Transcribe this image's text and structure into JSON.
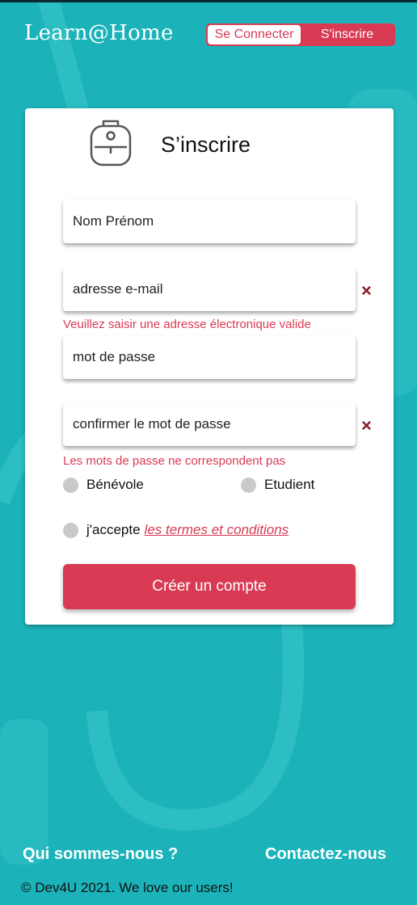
{
  "header": {
    "logo": "Learn@Home",
    "login_label": "Se Connecter",
    "signup_label": "S'inscrire"
  },
  "form": {
    "title": "S’inscrire",
    "name_placeholder": "Nom Prénom",
    "email_placeholder": "adresse e-mail",
    "email_error": "Veuillez saisir une adresse électronique valide",
    "password_placeholder": "mot de passe",
    "confirm_placeholder": "confirmer le mot de passe",
    "confirm_error": "Les mots de passe ne correspondent pas",
    "role_volunteer": "Bénévole",
    "role_student": "Etudient",
    "accept_text": "j'accepte",
    "terms_link": "les termes et conditions",
    "submit_label": "Créer un compte",
    "invalid_icon": "×"
  },
  "footer": {
    "about_link": "Qui sommes-nous ?",
    "contact_link": "Contactez-nous",
    "copyright": "© Dev4U 2021. We love our users!"
  },
  "colors": {
    "background": "#1bb3b9",
    "accent": "#d93a53",
    "error_icon": "#8a1a24"
  },
  "icons": {
    "bag": "backpack-icon",
    "invalid": "close-icon"
  }
}
